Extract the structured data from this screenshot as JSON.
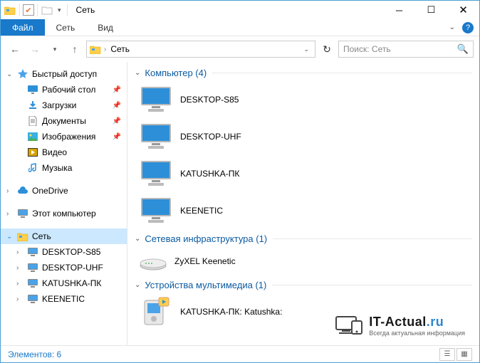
{
  "title": "Сеть",
  "tabs": {
    "file": "Файл",
    "network": "Сеть",
    "view": "Вид"
  },
  "addr": {
    "crumb": "Сеть"
  },
  "search": {
    "placeholder": "Поиск: Сеть"
  },
  "sidebar": {
    "quick": "Быстрый доступ",
    "desktop": "Рабочий стол",
    "downloads": "Загрузки",
    "documents": "Документы",
    "pictures": "Изображения",
    "videos": "Видео",
    "music": "Музыка",
    "onedrive": "OneDrive",
    "thispc": "Этот компьютер",
    "network": "Сеть",
    "net_items": [
      "DESKTOP-S85",
      "DESKTOP-UHF",
      "KATUSHKA-ПК",
      "KEENETIC"
    ]
  },
  "groups": {
    "computers": {
      "label": "Компьютер (4)",
      "items": [
        "DESKTOP-S85",
        "DESKTOP-UHF",
        "KATUSHKA-ПК",
        "KEENETIC"
      ]
    },
    "infra": {
      "label": "Сетевая инфраструктура (1)",
      "items": [
        "ZyXEL Keenetic"
      ]
    },
    "media": {
      "label": "Устройства мультимедиа (1)",
      "items": [
        "KATUSHKA-ПК: Katushka:"
      ]
    }
  },
  "status": "Элементов: 6",
  "watermark": {
    "brand": "IT-Actual",
    "tld": ".ru",
    "tagline": "Всегда актуальная информация"
  }
}
